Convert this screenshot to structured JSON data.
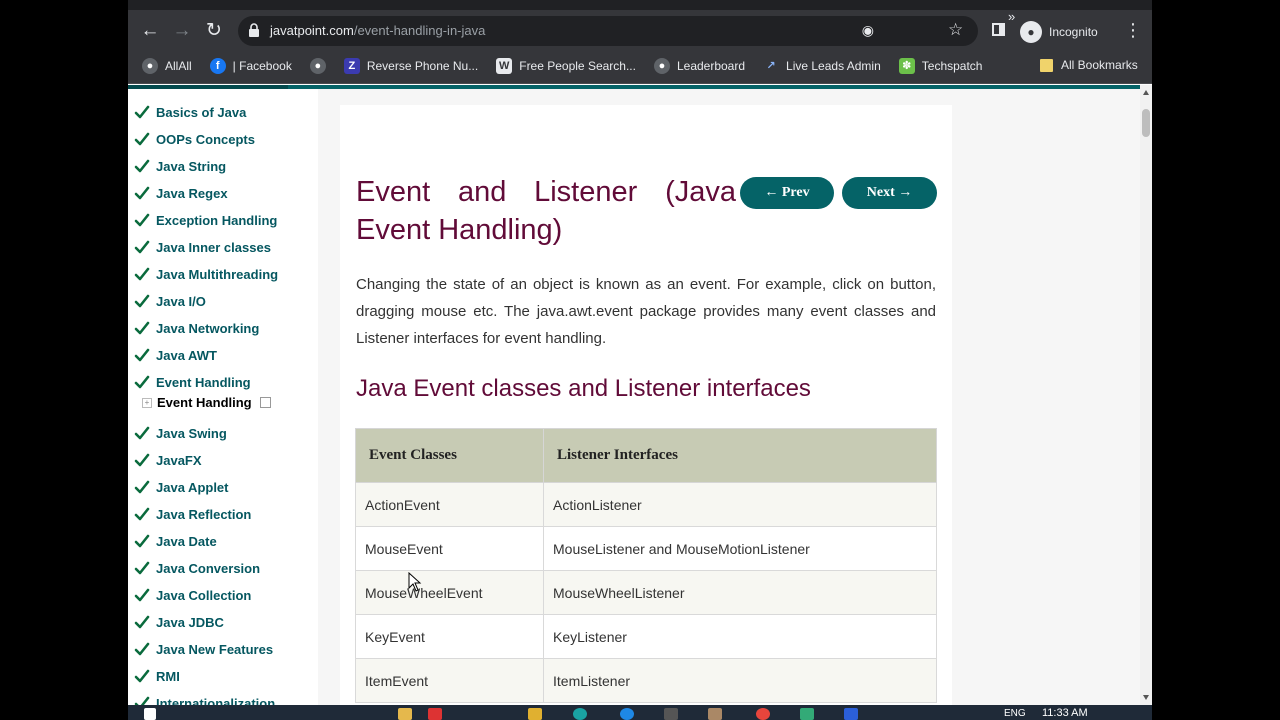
{
  "browser": {
    "url_host": "javatpoint.com",
    "url_path": "/event-handling-in-java",
    "profile_label": "Incognito",
    "icons": {
      "back": "back-arrow-icon",
      "forward": "forward-arrow-icon",
      "reload": "reload-icon",
      "lock": "lock-icon",
      "eye": "eye-off-icon",
      "star": "star-icon",
      "menu": "kebab-menu-icon"
    }
  },
  "bookmarks": {
    "items": [
      {
        "label": "AllAll",
        "icon": "globe-icon"
      },
      {
        "label": "| Facebook",
        "icon": "facebook-icon"
      },
      {
        "label": "Reverse Phone Nu...",
        "icon": "globe-icon"
      },
      {
        "label": "Free People Search...",
        "icon": "z-icon"
      },
      {
        "label": "Leaderboard",
        "icon": "w-icon"
      },
      {
        "label": "Live Leads Admin",
        "icon": "globe-icon"
      },
      {
        "label": "Techspatch",
        "icon": "leaf-icon"
      }
    ],
    "more": "»",
    "all_bookmarks": "All Bookmarks"
  },
  "sidebar": {
    "items": [
      "Basics of Java",
      "OOPs Concepts",
      "Java String",
      "Java Regex",
      "Exception Handling",
      "Java Inner classes",
      "Java Multithreading",
      "Java I/O",
      "Java Networking",
      "Java AWT",
      "Event Handling",
      "Java Swing",
      "JavaFX",
      "Java Applet",
      "Java Reflection",
      "Java Date",
      "Java Conversion",
      "Java Collection",
      "Java JDBC",
      "Java New Features",
      "RMI",
      "Internationalization"
    ],
    "subitem": "Event Handling"
  },
  "content": {
    "title_line1": "Event and Listener (Java",
    "title_line2": "Event Handling)",
    "prev_label": "← Prev",
    "next_label": "Next →",
    "intro": "Changing the state of an object is known as an event. For example, click on button, dragging mouse etc. The java.awt.event package provides many event classes and Listener interfaces for event handling.",
    "section_title": "Java Event classes and Listener interfaces",
    "table": {
      "headers": [
        "Event Classes",
        "Listener Interfaces"
      ],
      "rows": [
        [
          "ActionEvent",
          "ActionListener"
        ],
        [
          "MouseEvent",
          "MouseListener and MouseMotionListener"
        ],
        [
          "MouseWheelEvent",
          "MouseWheelListener"
        ],
        [
          "KeyEvent",
          "KeyListener"
        ],
        [
          "ItemEvent",
          "ItemListener"
        ]
      ]
    }
  },
  "taskbar": {
    "lang": "ENG",
    "time": "11:33 AM"
  },
  "colors": {
    "accent": "#056367",
    "heading": "#610b38",
    "table_header": "#c7cbb4"
  }
}
